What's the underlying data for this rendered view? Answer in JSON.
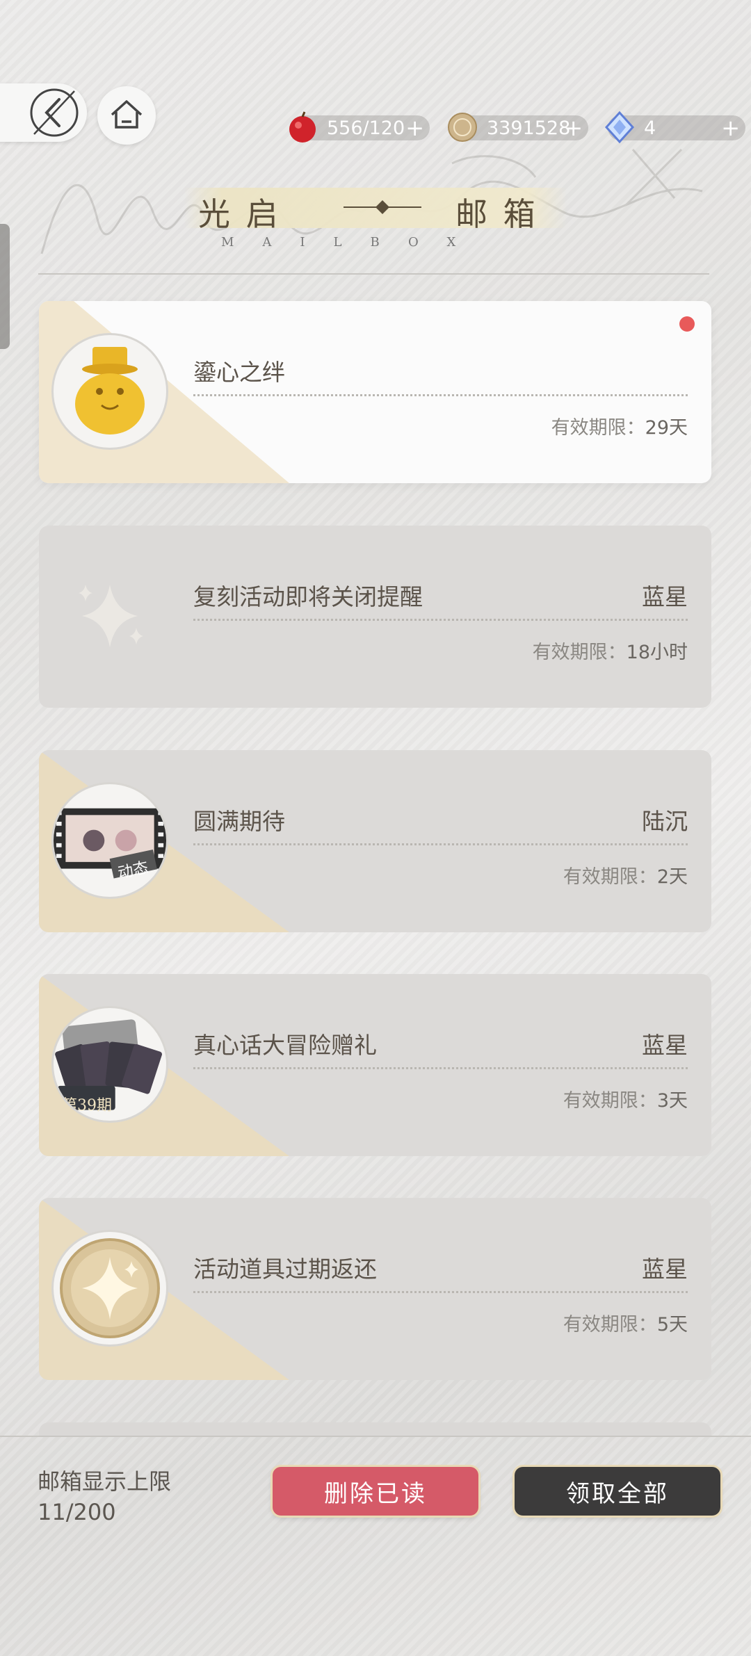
{
  "nav": {
    "back_icon": "back-arrow-icon",
    "home_icon": "home-icon"
  },
  "currency": [
    {
      "icon": "apple-icon",
      "value": "556/120"
    },
    {
      "icon": "coin-icon",
      "value": "3391528"
    },
    {
      "icon": "diamond-icon",
      "value": "4"
    }
  ],
  "header": {
    "title_left": "光 启",
    "title_right": "邮 箱",
    "subtitle": "MAILBOX"
  },
  "mails": [
    {
      "subject": "鎏心之绊",
      "sender": "",
      "expiry_label": "有效期限：",
      "expiry_value": "29天",
      "unread": true,
      "icon": "gold-figurine-icon"
    },
    {
      "subject": "复刻活动即将关闭提醒",
      "sender": "蓝星",
      "expiry_label": "有效期限：",
      "expiry_value": "18小时",
      "unread": false,
      "icon": "sparkle-icon"
    },
    {
      "subject": "圆满期待",
      "sender": "陆沉",
      "expiry_label": "有效期限：",
      "expiry_value": "2天",
      "unread": false,
      "icon": "dynamic-photo-icon",
      "badge": "动态"
    },
    {
      "subject": "真心话大冒险赠礼",
      "sender": "蓝星",
      "expiry_label": "有效期限：",
      "expiry_value": "3天",
      "unread": false,
      "icon": "card-pack-icon",
      "badge": "第39期"
    },
    {
      "subject": "活动道具过期返还",
      "sender": "蓝星",
      "expiry_label": "有效期限：",
      "expiry_value": "5天",
      "unread": false,
      "icon": "gold-sparkle-coin-icon"
    }
  ],
  "footer": {
    "limit_label": "邮箱显示上限",
    "limit_value": "11/200",
    "delete_read_label": "删除已读",
    "claim_all_label": "领取全部"
  },
  "colors": {
    "unread_dot": "#e85a5a",
    "delete_button": "#d55a68",
    "claim_button": "#3c3b3b"
  }
}
